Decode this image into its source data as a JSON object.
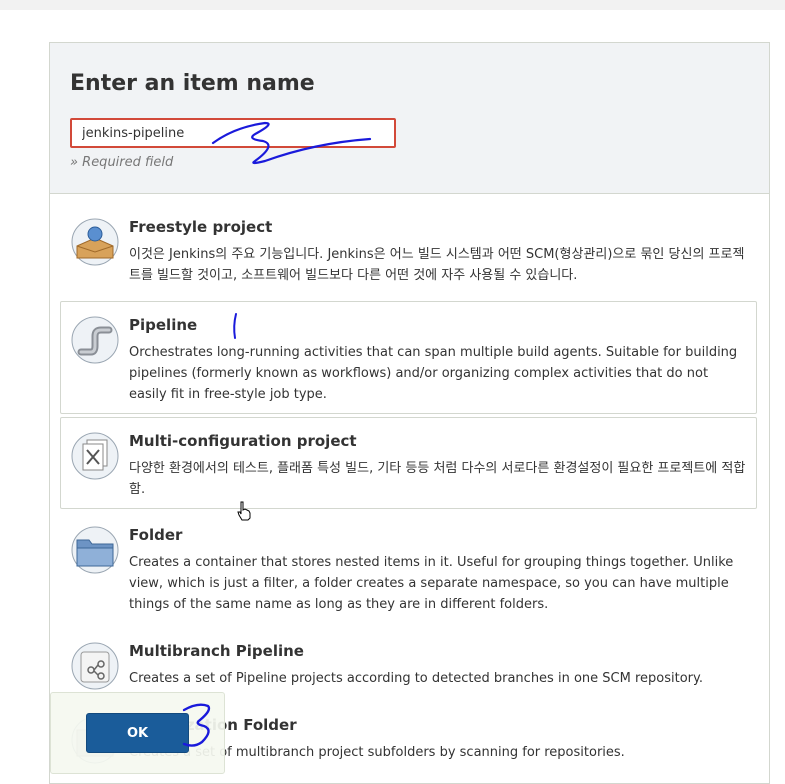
{
  "header": {
    "title": "Enter an item name",
    "input_value": "jenkins-pipeline",
    "required_hint": "» Required field"
  },
  "items": [
    {
      "icon": "freestyle-project-icon",
      "title": "Freestyle project",
      "description": "이것은 Jenkins의 주요 기능입니다. Jenkins은 어느 빌드 시스템과 어떤 SCM(형상관리)으로 묶인 당신의 프로젝트를 빌드할 것이고, 소프트웨어 빌드보다 다른 어떤 것에 자주 사용될 수 있습니다."
    },
    {
      "icon": "pipeline-icon",
      "title": "Pipeline",
      "description": "Orchestrates long-running activities that can span multiple build agents. Suitable for building pipelines (formerly known as workflows) and/or organizing complex activities that do not easily fit in free-style job type."
    },
    {
      "icon": "multi-configuration-icon",
      "title": "Multi-configuration project",
      "description": "다양한 환경에서의 테스트, 플래폼 특성 빌드, 기타 등등 처럼 다수의 서로다른 환경설정이 필요한 프로젝트에 적합함."
    },
    {
      "icon": "folder-icon",
      "title": "Folder",
      "description": "Creates a container that stores nested items in it. Useful for grouping things together. Unlike view, which is just a filter, a folder creates a separate namespace, so you can have multiple things of the same name as long as they are in different folders."
    },
    {
      "icon": "multibranch-pipeline-icon",
      "title": "Multibranch Pipeline",
      "description": "Creates a set of Pipeline projects according to detected branches in one SCM repository."
    },
    {
      "icon": "organization-folder-icon",
      "title": "Organization Folder",
      "description": "Creates a set of multibranch project subfolders by scanning for repositories."
    }
  ],
  "footer": {
    "ok_label": "OK"
  },
  "colors": {
    "input_border": "#d24939",
    "ok_button": "#1a5c9a",
    "annotation_ink": "#1a1adb"
  }
}
